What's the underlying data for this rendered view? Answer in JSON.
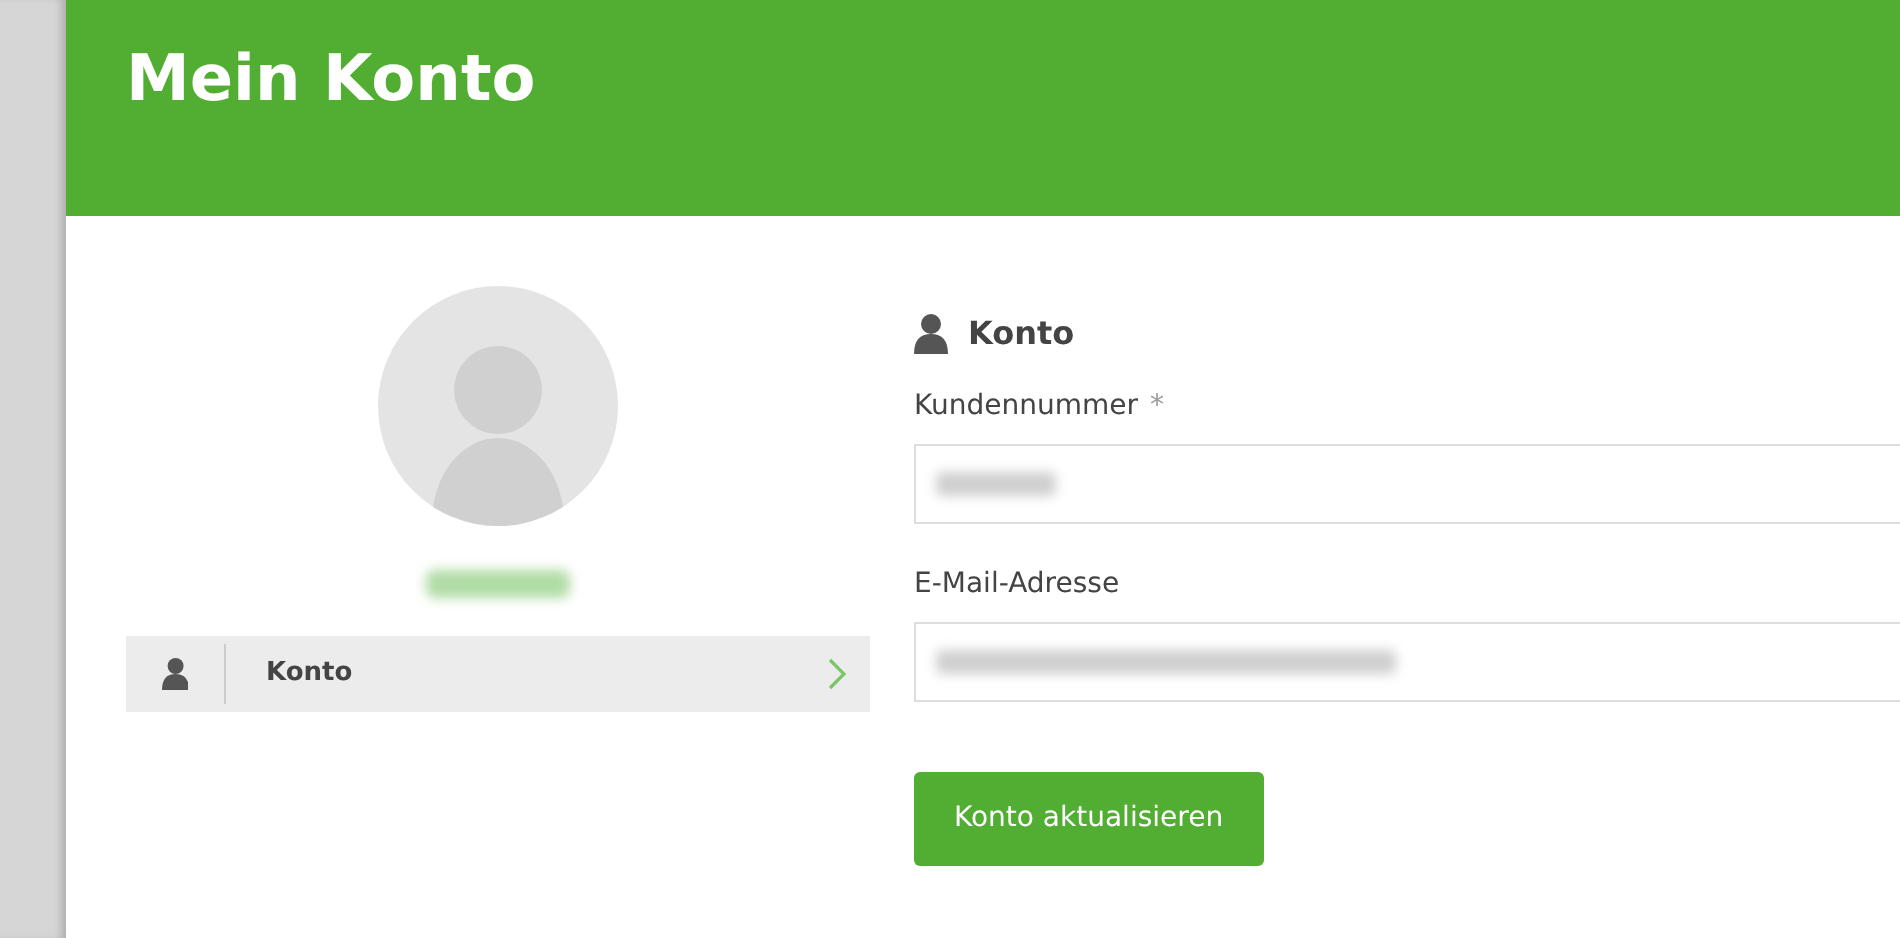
{
  "header": {
    "title": "Mein Konto"
  },
  "sidebar": {
    "items": [
      {
        "label": "Konto",
        "selected": true
      }
    ]
  },
  "form": {
    "heading": "Konto",
    "fields": [
      {
        "label": "Kundennummer",
        "required_mark": "*"
      },
      {
        "label": "E-Mail-Adresse"
      }
    ],
    "submit": "Konto aktualisieren"
  }
}
